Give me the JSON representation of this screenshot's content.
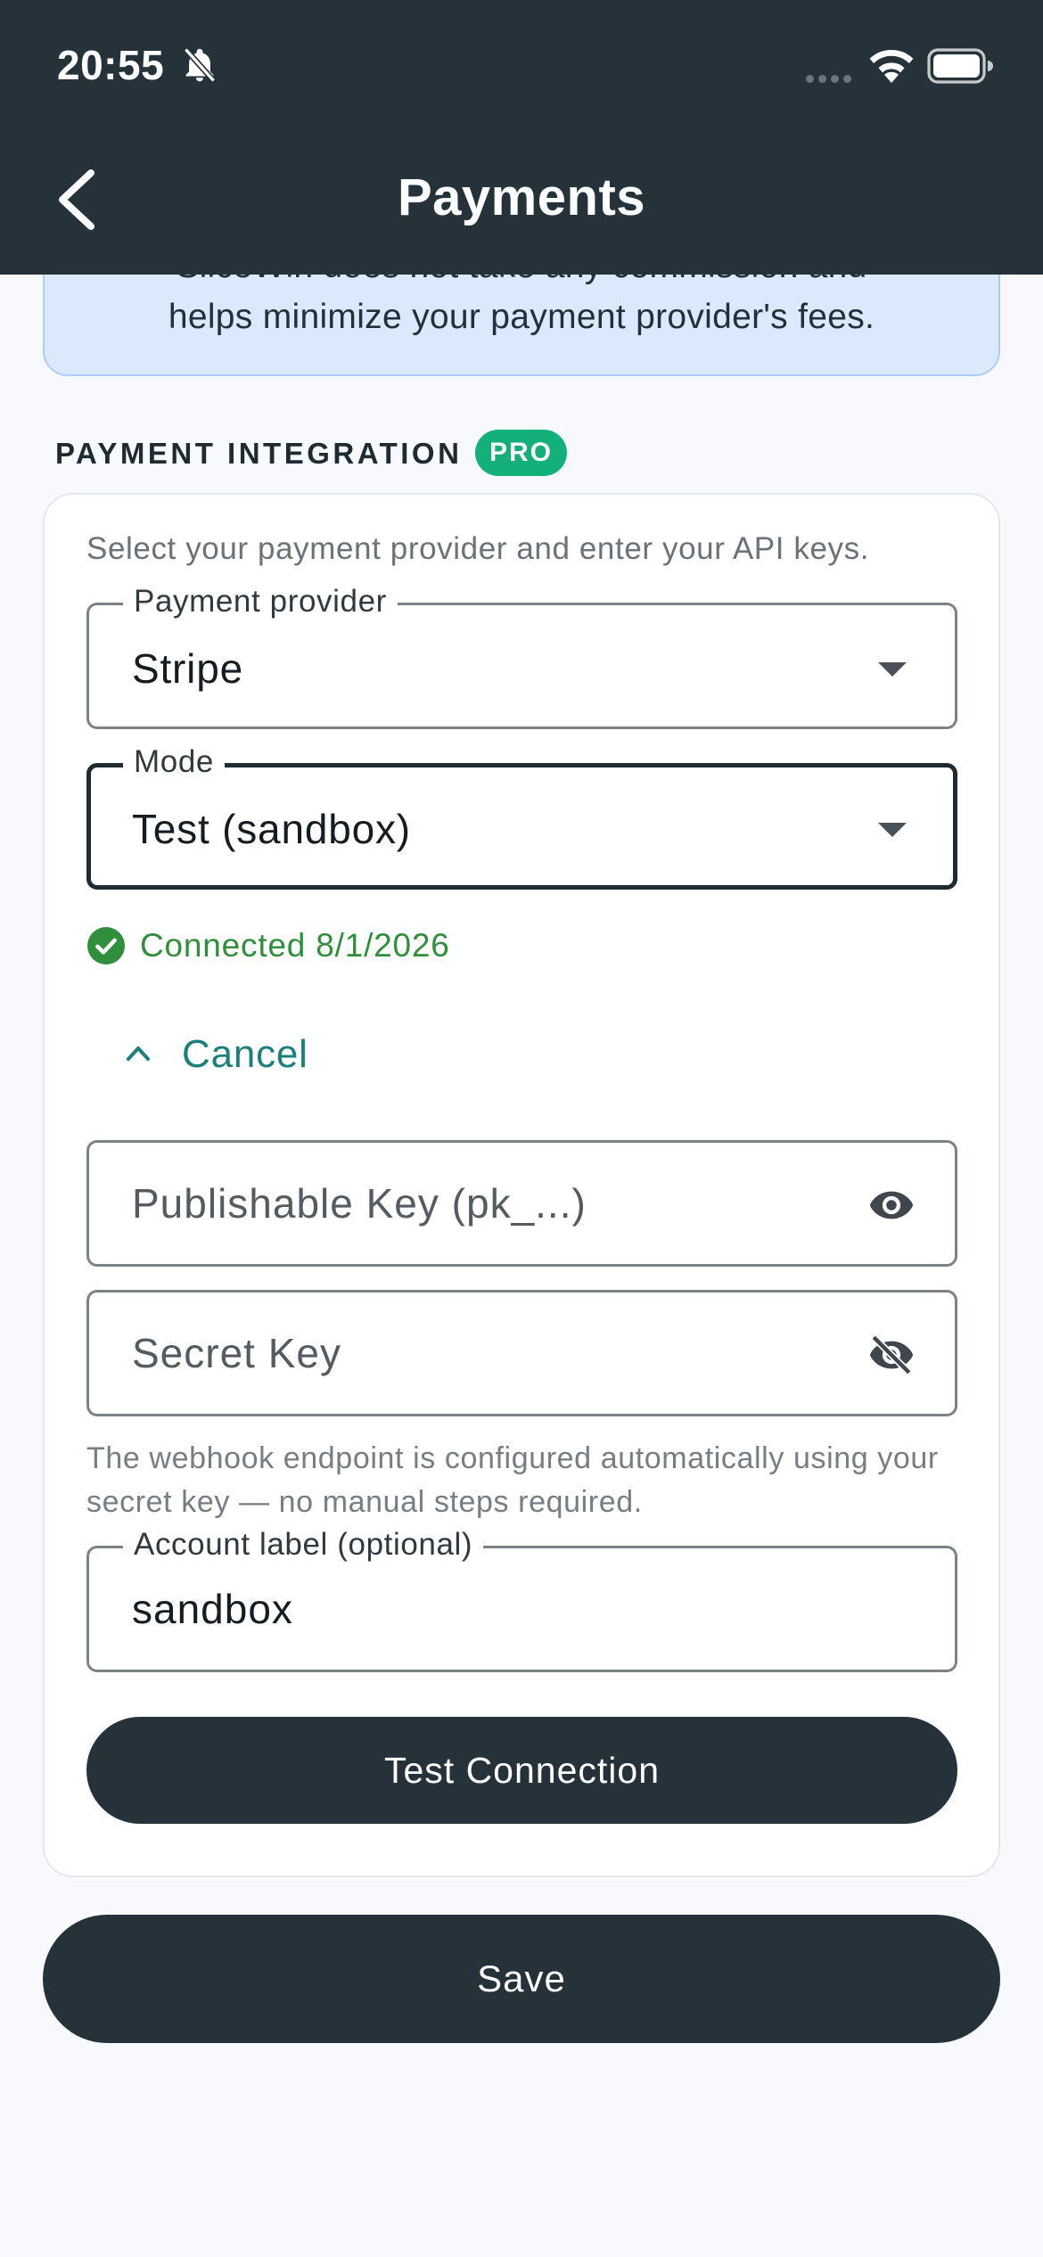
{
  "status_bar": {
    "time": "20:55",
    "icons": [
      "bell-off-icon",
      "signal-dots-icon",
      "wifi-icon",
      "battery-icon"
    ]
  },
  "header": {
    "title": "Payments",
    "back_icon": "chevron-left-icon"
  },
  "info_banner": {
    "line1": "SliceWin does not take any commission and",
    "line2": "helps minimize your payment provider's fees."
  },
  "section": {
    "title": "PAYMENT INTEGRATION",
    "badge": "PRO"
  },
  "card": {
    "description": "Select your payment provider and enter your API keys.",
    "provider": {
      "label": "Payment provider",
      "value": "Stripe"
    },
    "mode": {
      "label": "Mode",
      "value": "Test (sandbox)"
    },
    "connected_status": "Connected 8/1/2026",
    "cancel_label": "Cancel",
    "publishable_key": {
      "placeholder": "Publishable Key (pk_...)",
      "value": "",
      "icon": "eye-icon"
    },
    "secret_key": {
      "placeholder": "Secret Key",
      "value": "",
      "icon": "eye-off-icon"
    },
    "hint": "The webhook endpoint is configured automatically using your secret key — no manual steps required.",
    "account_label": {
      "label": "Account label (optional)",
      "value": "sandbox"
    },
    "test_button": "Test Connection"
  },
  "save_button": "Save",
  "colors": {
    "header_bg": "#25323a",
    "banner_bg": "#dbe9fd",
    "pro_badge": "#14b07a",
    "connected_green": "#2f8f3a",
    "cancel_teal": "#1b7f7b",
    "button_dark": "#25323a"
  }
}
